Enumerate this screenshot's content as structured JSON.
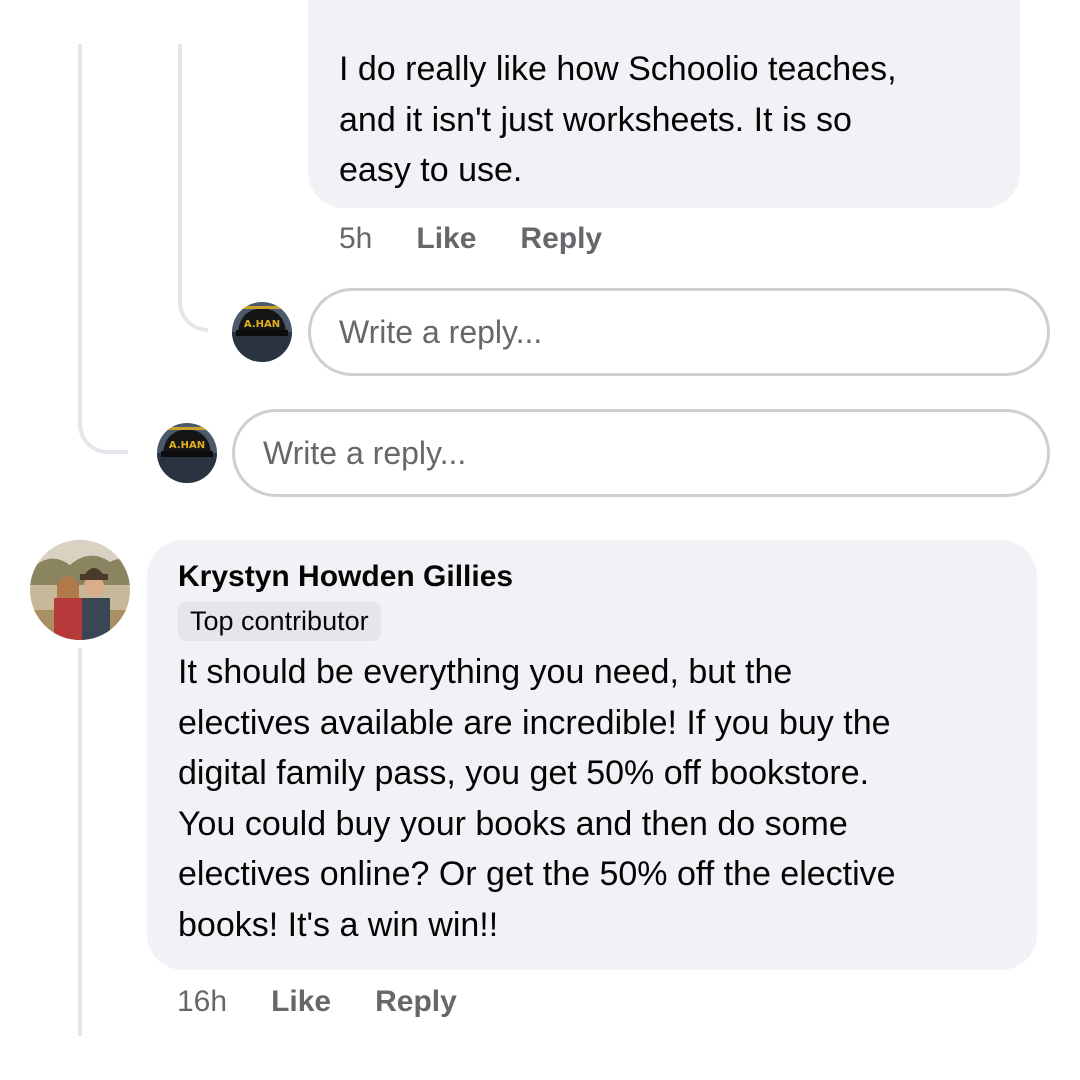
{
  "previous_reply": {
    "text": "I do really like how Schoolio teaches,\nand it isn't just worksheets. It is so\neasy to use.",
    "time": "5h",
    "like_label": "Like",
    "reply_label": "Reply"
  },
  "nested_reply_box": {
    "placeholder": "Write a reply..."
  },
  "thread_reply_box": {
    "placeholder": "Write a reply..."
  },
  "user_avatar": {
    "hat_text": "A.HAN"
  },
  "comment": {
    "author": "Krystyn Howden Gillies",
    "badge": "Top contributor",
    "text": "It should be everything you need, but the\nelectives available are incredible! If you buy the\ndigital family pass, you get 50% off bookstore.\nYou could buy your books and then do some\nelectives online? Or get the 50% off the elective\nbooks! It's a win win!!",
    "time": "16h",
    "like_label": "Like",
    "reply_label": "Reply"
  },
  "colors": {
    "bubble": "#f0f2f5",
    "text": "#050505",
    "muted": "#65676b",
    "thread_line": "#e4e6eb"
  }
}
